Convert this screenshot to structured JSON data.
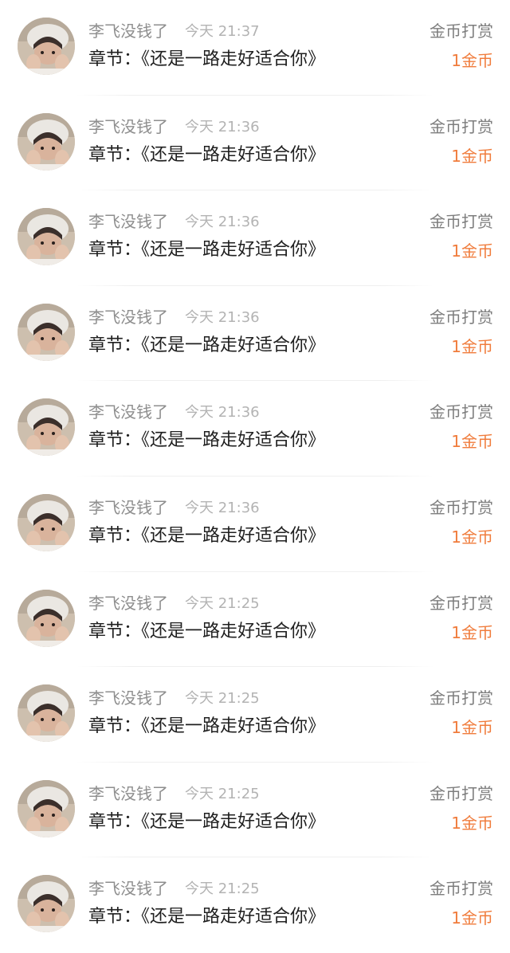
{
  "rows": [
    {
      "username": "李飞没钱了",
      "time": "今天 21:37",
      "type": "金币打赏",
      "chapter": "章节：《还是一路走好适合你》",
      "amount": "1金币"
    },
    {
      "username": "李飞没钱了",
      "time": "今天 21:36",
      "type": "金币打赏",
      "chapter": "章节：《还是一路走好适合你》",
      "amount": "1金币"
    },
    {
      "username": "李飞没钱了",
      "time": "今天 21:36",
      "type": "金币打赏",
      "chapter": "章节：《还是一路走好适合你》",
      "amount": "1金币"
    },
    {
      "username": "李飞没钱了",
      "time": "今天 21:36",
      "type": "金币打赏",
      "chapter": "章节：《还是一路走好适合你》",
      "amount": "1金币"
    },
    {
      "username": "李飞没钱了",
      "time": "今天 21:36",
      "type": "金币打赏",
      "chapter": "章节：《还是一路走好适合你》",
      "amount": "1金币"
    },
    {
      "username": "李飞没钱了",
      "time": "今天 21:36",
      "type": "金币打赏",
      "chapter": "章节：《还是一路走好适合你》",
      "amount": "1金币"
    },
    {
      "username": "李飞没钱了",
      "time": "今天 21:25",
      "type": "金币打赏",
      "chapter": "章节：《还是一路走好适合你》",
      "amount": "1金币"
    },
    {
      "username": "李飞没钱了",
      "time": "今天 21:25",
      "type": "金币打赏",
      "chapter": "章节：《还是一路走好适合你》",
      "amount": "1金币"
    },
    {
      "username": "李飞没钱了",
      "time": "今天 21:25",
      "type": "金币打赏",
      "chapter": "章节：《还是一路走好适合你》",
      "amount": "1金币"
    },
    {
      "username": "李飞没钱了",
      "time": "今天 21:25",
      "type": "金币打赏",
      "chapter": "章节：《还是一路走好适合你》",
      "amount": "1金币"
    }
  ],
  "colors": {
    "amount": "#f07c3c",
    "username": "#8e8e8e",
    "time": "#b3b3b3",
    "chapter": "#1f1f1f"
  }
}
